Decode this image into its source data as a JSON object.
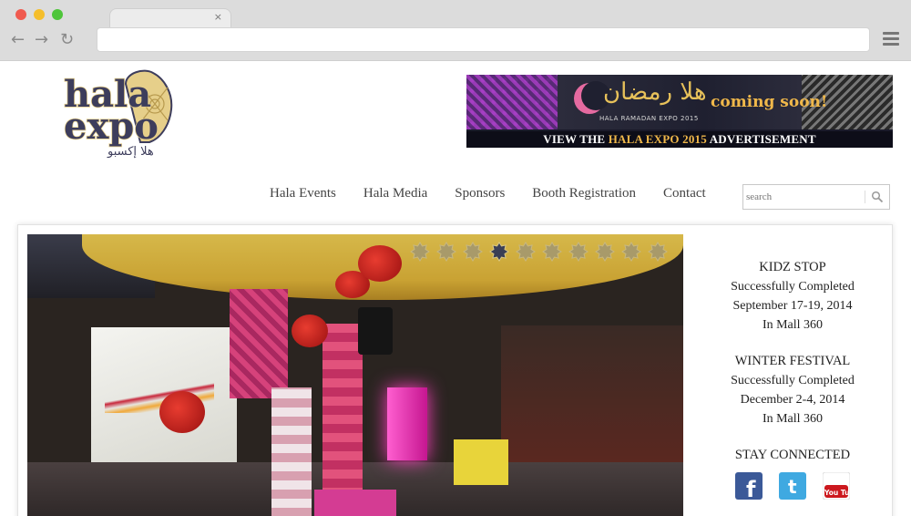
{
  "browser": {
    "tab_close_glyph": "×",
    "back_glyph": "←",
    "forward_glyph": "→",
    "reload_glyph": "↻",
    "address_value": ""
  },
  "ad": {
    "arabic_title": "هلا رمضان",
    "subtitle": "HALA RAMADAN EXPO 2015",
    "coming": "coming soon!",
    "bottom_prefix": "VIEW THE ",
    "bottom_highlight": "HALA EXPO 2015",
    "bottom_suffix": " ADVERTISEMENT"
  },
  "nav": {
    "items": [
      {
        "label": "Hala Events"
      },
      {
        "label": "Hala Media"
      },
      {
        "label": "Sponsors"
      },
      {
        "label": "Booth Registration"
      },
      {
        "label": "Contact"
      }
    ]
  },
  "search": {
    "placeholder": "search",
    "value": ""
  },
  "slider": {
    "dot_count": 10,
    "active_dot": 3
  },
  "sidebar": {
    "events": [
      {
        "title": "KIDZ STOP",
        "status": "Successfully Completed",
        "dates": "September 17-19, 2014",
        "venue": "In Mall 360"
      },
      {
        "title": "WINTER FESTIVAL",
        "status": "Successfully Completed",
        "dates": "December 2-4, 2014",
        "venue": "In Mall 360"
      }
    ],
    "stay_connected": "STAY CONNECTED",
    "social": [
      {
        "name": "facebook",
        "glyph": "f"
      },
      {
        "name": "twitter",
        "glyph": "t"
      },
      {
        "name": "youtube",
        "glyph": "You Tube"
      }
    ]
  },
  "colors": {
    "chrome_bg": "#dcdcdc",
    "accent_gold": "#f0b84a",
    "facebook_blue": "#3b5998",
    "twitter_blue": "#3fa9e1",
    "youtube_red": "#cc181e"
  }
}
